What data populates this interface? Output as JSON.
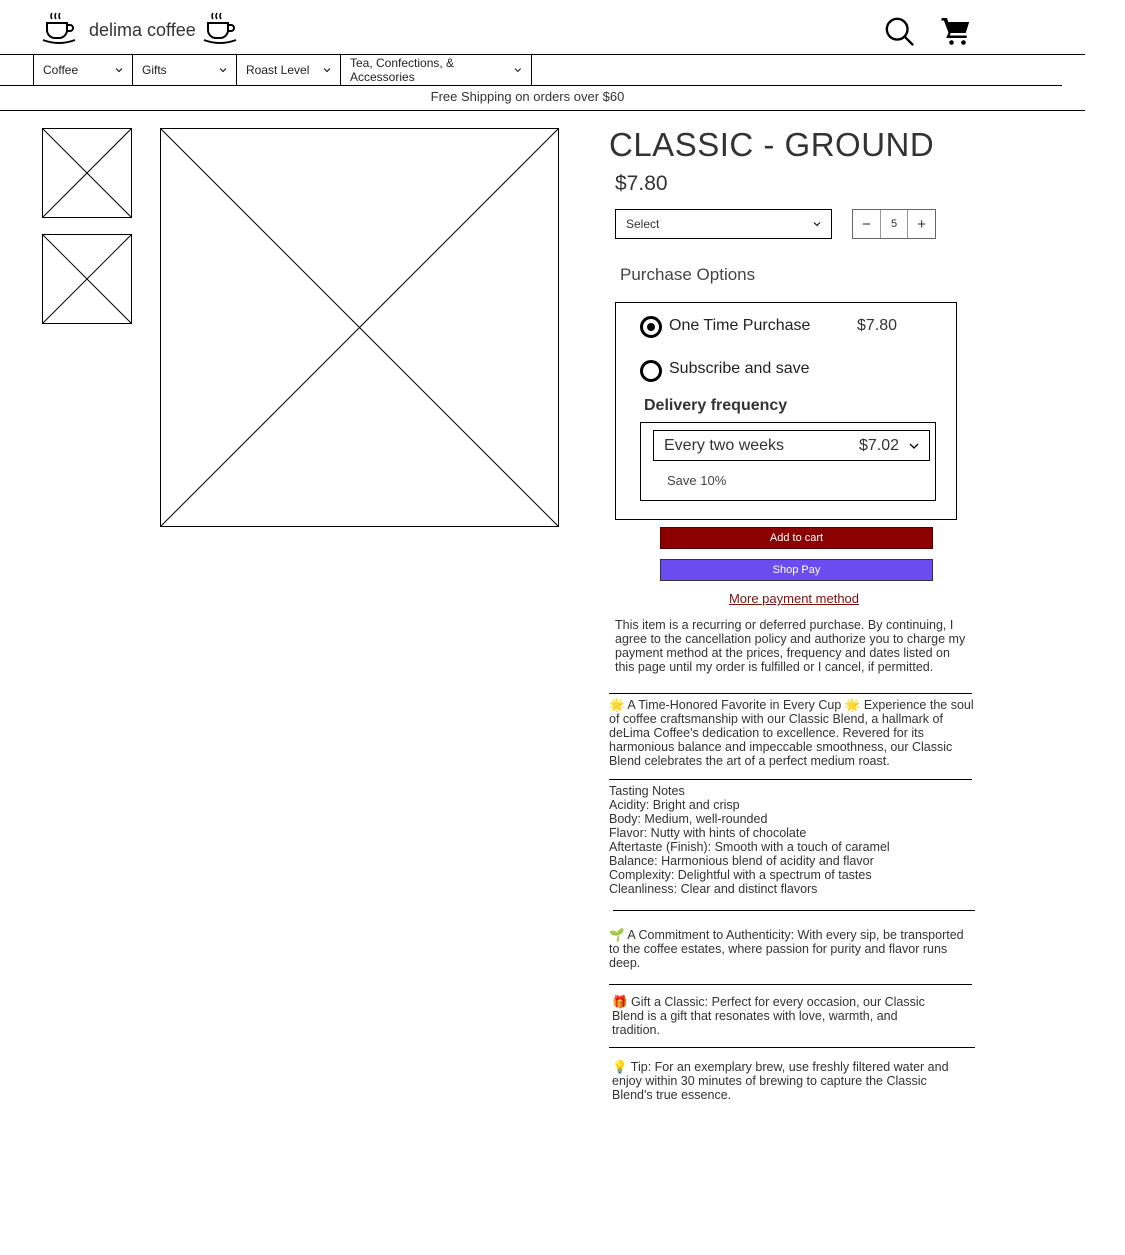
{
  "header": {
    "brand": "delima coffee",
    "left_icon": "coffee-cup-icon",
    "right_icon": "coffee-cup-icon",
    "search_icon": "search-icon",
    "cart_icon": "cart-icon"
  },
  "nav": {
    "items": [
      {
        "label": "Coffee"
      },
      {
        "label": "Gifts"
      },
      {
        "label": "Roast Level"
      },
      {
        "label": "Tea, Confections, & Accessories"
      }
    ]
  },
  "promo": "Free Shipping on orders over $60",
  "product": {
    "title": "CLASSIC - GROUND",
    "price": "$7.80",
    "variant_select": "Select",
    "quantity": "5",
    "qty_minus": "−",
    "qty_plus": "+"
  },
  "purchase_options": {
    "label": "Purchase Options",
    "one_time_label": "One Time Purchase",
    "one_time_price": "$7.80",
    "subscribe_label": "Subscribe and save",
    "frequency_label": "Delivery frequency",
    "frequency_value": "Every two weeks",
    "frequency_price": "$7.02",
    "save_text": "Save 10%"
  },
  "buttons": {
    "add_to_cart": "Add to cart",
    "shop_pay": "Shop Pay",
    "more_payment": "More payment method"
  },
  "policy_text": "This item is a recurring or deferred purchase. By continuing, I agree to the cancellation policy and authorize you to charge my payment method at the prices, frequency and dates listed on this page until my order is fulfilled or I cancel, if permitted.",
  "description": {
    "intro": "🌟 A Time-Honored Favorite in Every Cup 🌟 Experience the soul of coffee craftsmanship with our Classic Blend, a hallmark of deLima Coffee's dedication to excellence. Revered for its harmonious balance and impeccable smoothness, our Classic Blend celebrates the art of a perfect medium roast.",
    "tasting_notes": [
      "Tasting Notes",
      "Acidity: Bright and crisp",
      "Body: Medium, well-rounded",
      "Flavor: Nutty with hints of chocolate",
      "Aftertaste (Finish): Smooth with a touch of caramel",
      "Balance: Harmonious blend of acidity and flavor",
      "Complexity: Delightful with a spectrum of tastes",
      "Cleanliness: Clear and distinct flavors"
    ],
    "authenticity": "🌱 A Commitment to Authenticity: With every sip, be transported to the coffee estates, where passion for purity and flavor runs deep.",
    "gift": "🎁 Gift a Classic: Perfect for every occasion, our Classic Blend is a gift that resonates with love, warmth, and tradition.",
    "tip": "💡 Tip: For an exemplary brew, use freshly filtered water and enjoy within 30 minutes of brewing to capture the Classic Blend's true essence."
  }
}
